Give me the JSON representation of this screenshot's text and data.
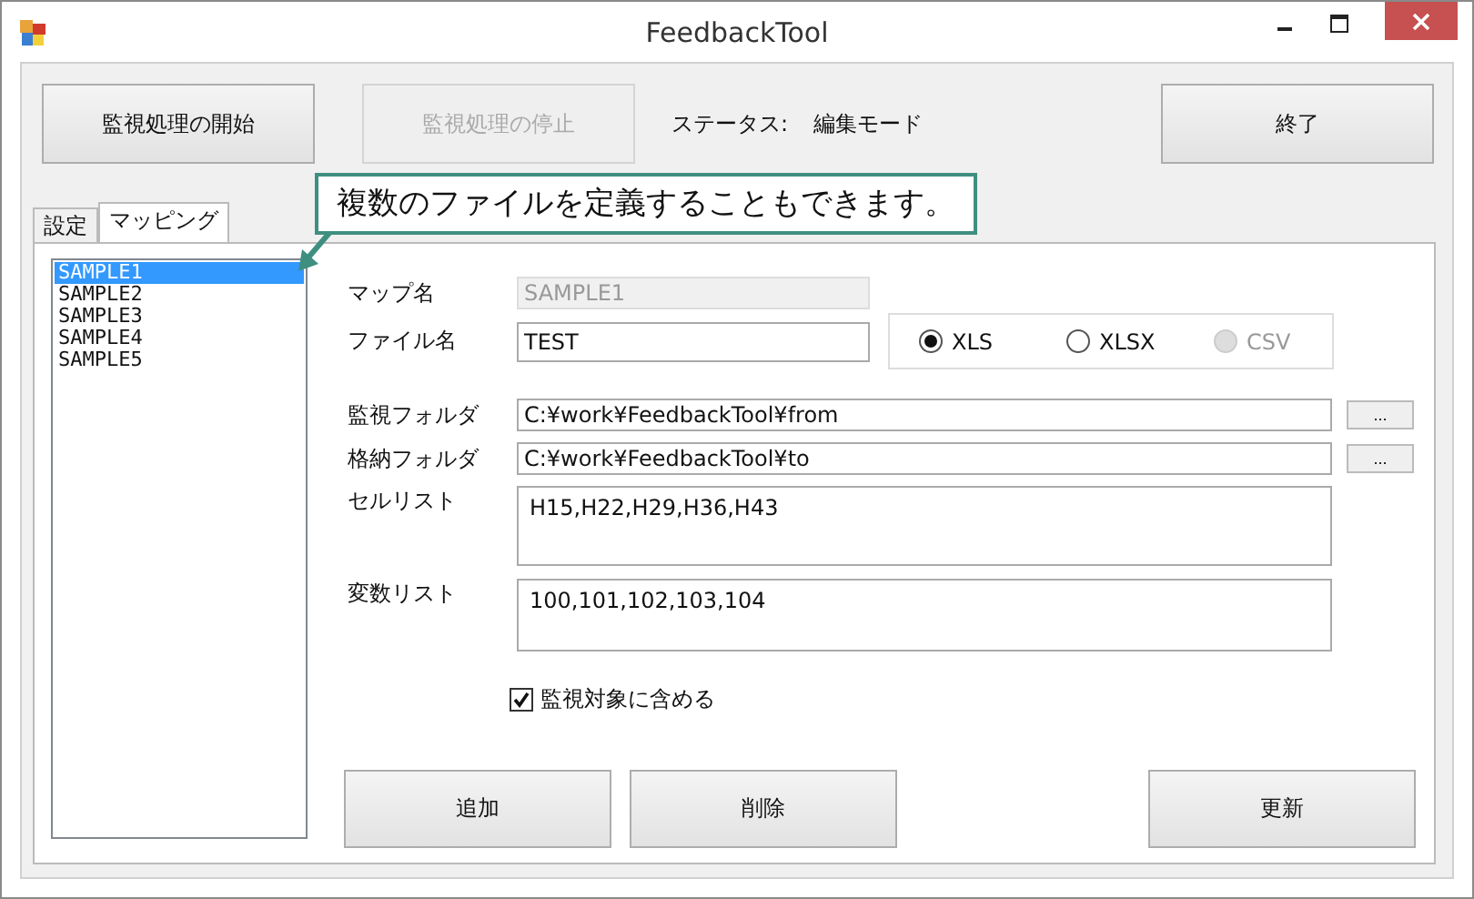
{
  "window": {
    "title": "FeedbackTool"
  },
  "toolbar": {
    "buttons": [
      {
        "label": "監視処理の開始",
        "disabled": false
      },
      {
        "label": "監視処理の停止",
        "disabled": true
      }
    ],
    "status_label": "ステータス:",
    "status_value": "編集モード",
    "exit_button": "終了"
  },
  "callout": "複数のファイルを定義することもできます。",
  "tabs": [
    {
      "label": "設定",
      "selected": false
    },
    {
      "label": "マッピング",
      "selected": true
    }
  ],
  "map_list": [
    {
      "name": "SAMPLE1",
      "selected": true
    },
    {
      "name": "SAMPLE2",
      "selected": false
    },
    {
      "name": "SAMPLE3",
      "selected": false
    },
    {
      "name": "SAMPLE4",
      "selected": false
    },
    {
      "name": "SAMPLE5",
      "selected": false
    }
  ],
  "form": {
    "map_name": {
      "label": "マップ名",
      "value": "SAMPLE1",
      "disabled": true
    },
    "file_name": {
      "label": "ファイル名",
      "value": "TEST",
      "disabled": false
    },
    "formats": [
      {
        "label": "XLS",
        "selected": true,
        "disabled": false
      },
      {
        "label": "XLSX",
        "selected": false,
        "disabled": false
      },
      {
        "label": "CSV",
        "selected": false,
        "disabled": true
      }
    ],
    "folders": [
      {
        "label": "監視フォルダ",
        "value": "C:¥work¥FeedbackTool¥from",
        "browse": "..."
      },
      {
        "label": "格納フォルダ",
        "value": "C:¥work¥FeedbackTool¥to",
        "browse": "..."
      }
    ],
    "lists": [
      {
        "label": "セルリスト",
        "value": "H15,H22,H29,H36,H43"
      },
      {
        "label": "変数リスト",
        "value": "100,101,102,103,104"
      }
    ],
    "include": {
      "label": "監視対象に含める",
      "checked": true
    },
    "buttons": [
      "追加",
      "削除"
    ],
    "update_button": "更新"
  }
}
